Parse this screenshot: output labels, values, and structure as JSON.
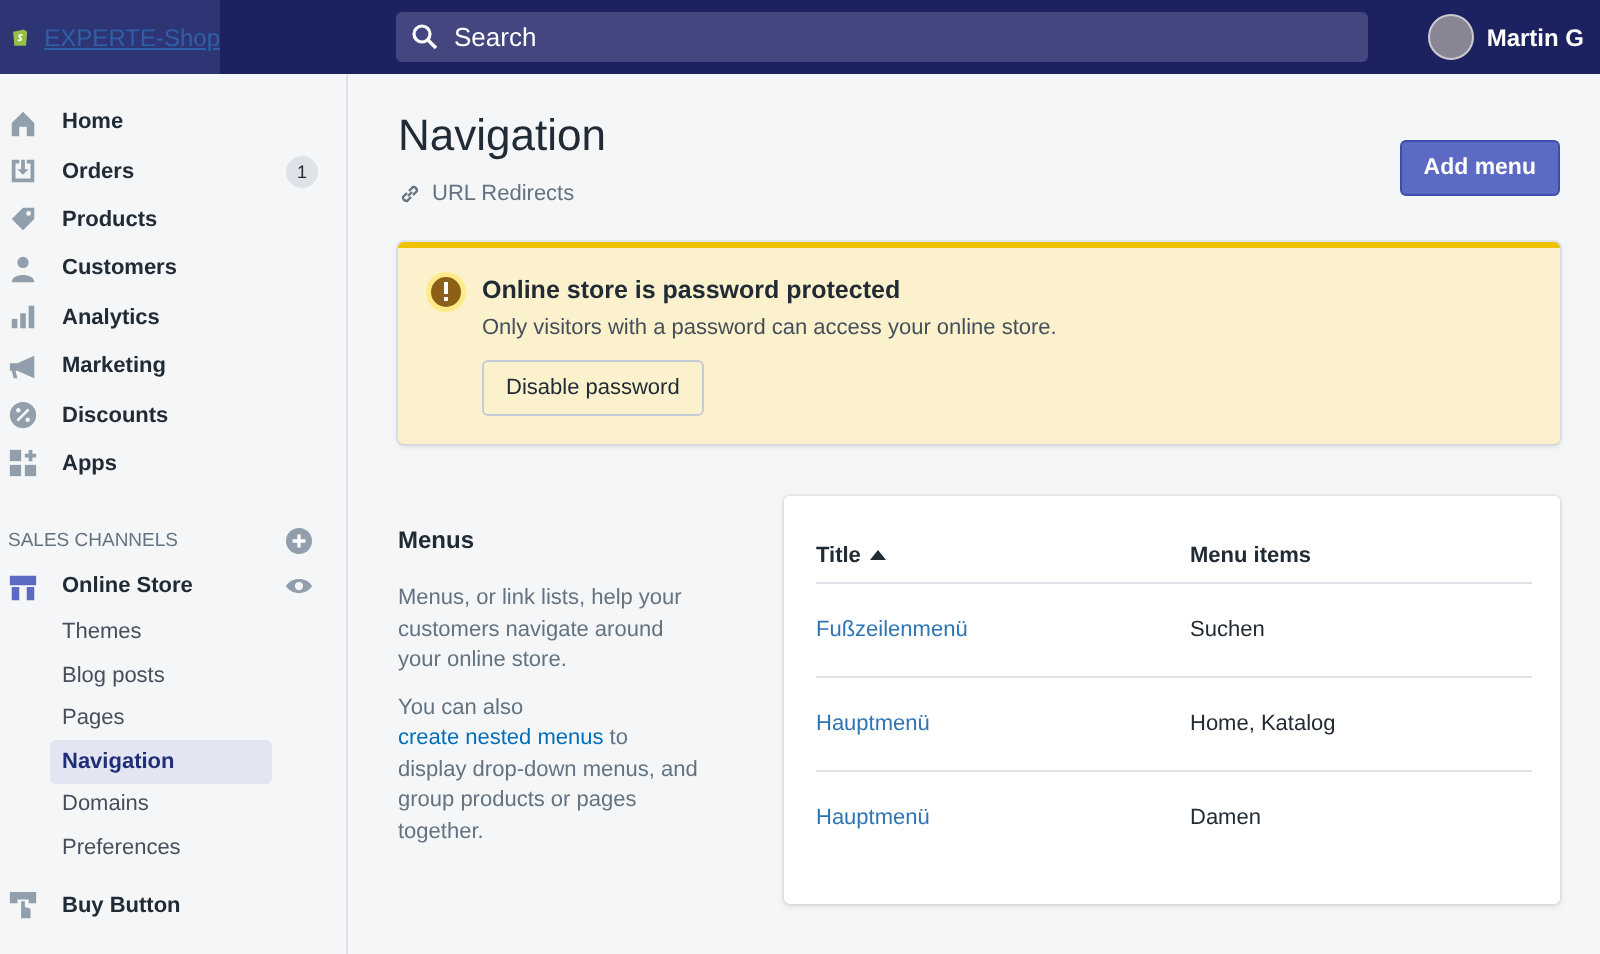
{
  "topbar": {
    "store_name": "EXPERTE-Shop",
    "search": {
      "placeholder": "Search"
    },
    "user": {
      "name": "Martin G"
    }
  },
  "sidebar": {
    "items": [
      {
        "label": "Home",
        "kind": "home"
      },
      {
        "label": "Orders",
        "kind": "orders",
        "badge": "1"
      },
      {
        "label": "Products",
        "kind": "tag"
      },
      {
        "label": "Customers",
        "kind": "person"
      },
      {
        "label": "Analytics",
        "kind": "bars"
      },
      {
        "label": "Marketing",
        "kind": "megaphone"
      },
      {
        "label": "Discounts",
        "kind": "discount"
      },
      {
        "label": "Apps",
        "kind": "apps"
      }
    ],
    "sales_channels": {
      "heading": "SALES CHANNELS",
      "channel": {
        "label": "Online Store",
        "children": [
          {
            "label": "Themes",
            "selected": false
          },
          {
            "label": "Blog posts",
            "selected": false
          },
          {
            "label": "Pages",
            "selected": false
          },
          {
            "label": "Navigation",
            "selected": true
          },
          {
            "label": "Domains",
            "selected": false
          },
          {
            "label": "Preferences",
            "selected": false
          }
        ]
      }
    },
    "more_items": [
      {
        "label": "Buy Button",
        "kind": "buy"
      }
    ]
  },
  "page": {
    "title": "Navigation",
    "secondary_action": "URL Redirects",
    "primary_action": "Add menu",
    "banner": {
      "kind": "warning",
      "title": "Online store is password protected",
      "message": "Only visitors with a password can access your online store.",
      "button": "Disable password"
    },
    "menus": {
      "heading": "Menus",
      "description": "Menus, or link lists, help your customers navigate around your online store.",
      "help": {
        "before": "You can also ",
        "link": "create nested menus",
        "after": " to display drop-down menus, and group products or pages together."
      },
      "table": {
        "columns": [
          {
            "label": "Title",
            "sorted": true
          },
          {
            "label": "Menu items",
            "sorted": false
          }
        ],
        "rows": [
          {
            "title": "Fußzeilenmenü",
            "items": "Suchen"
          },
          {
            "title": "Hauptmenü",
            "items": "Home, Katalog"
          },
          {
            "title": "Hauptmenü",
            "items": "Damen"
          }
        ]
      }
    }
  }
}
